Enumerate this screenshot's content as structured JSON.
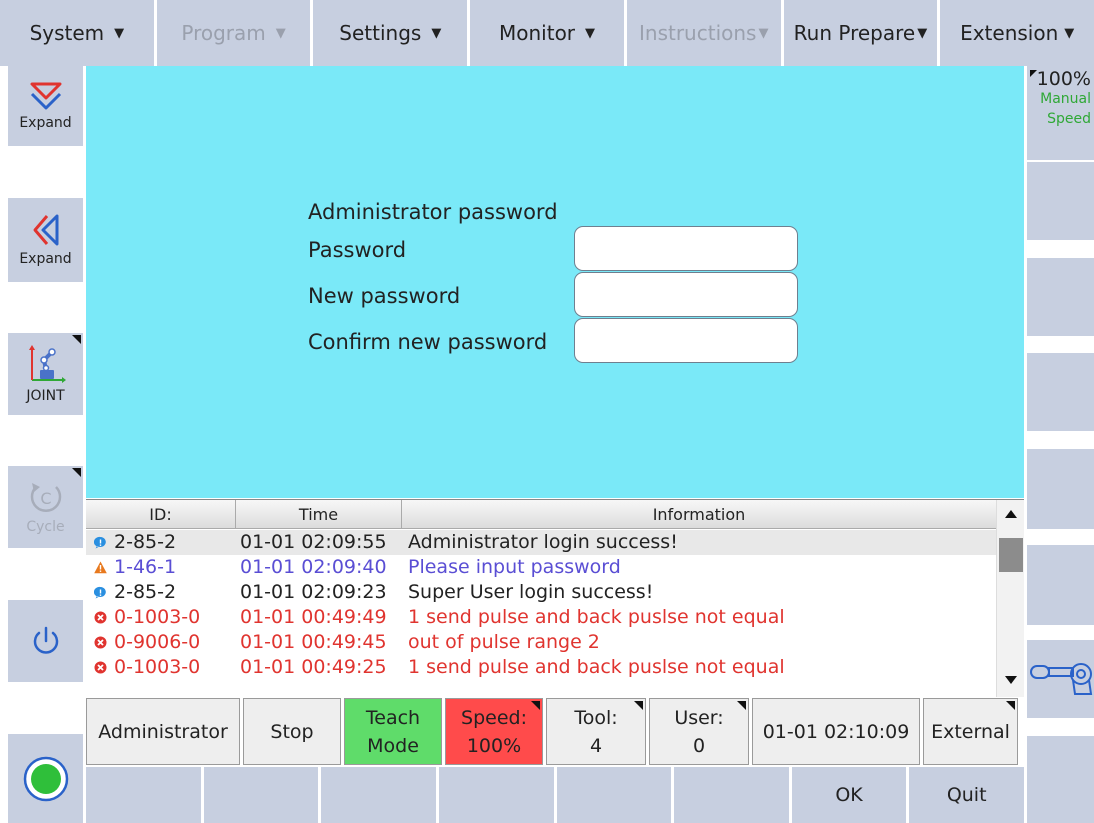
{
  "menu": [
    {
      "label": "System",
      "disabled": false
    },
    {
      "label": "Program",
      "disabled": true
    },
    {
      "label": "Settings",
      "disabled": false
    },
    {
      "label": "Monitor",
      "disabled": false
    },
    {
      "label": "Instructions",
      "disabled": true
    },
    {
      "label": "Run Prepare",
      "disabled": false
    },
    {
      "label": "Extension",
      "disabled": false
    }
  ],
  "left": {
    "expand_down": "Expand",
    "expand_left": "Expand",
    "coord": "JOINT",
    "cycle": "Cycle"
  },
  "speed": {
    "value": "100%",
    "mode": "Manual",
    "label": "Speed"
  },
  "form": {
    "title": "Administrator password",
    "password_label": "Password",
    "new_password_label": "New password",
    "confirm_label": "Confirm new password",
    "password_value": "",
    "new_password_value": "",
    "confirm_value": ""
  },
  "log": {
    "headers": {
      "id": "ID:",
      "time": "Time",
      "info": "Information"
    },
    "rows": [
      {
        "id": "2-85-2",
        "time": "01-01 02:09:55",
        "info": "Administrator login success!",
        "level": "info"
      },
      {
        "id": "1-46-1",
        "time": "01-01 02:09:40",
        "info": "Please input password",
        "level": "warning"
      },
      {
        "id": "2-85-2",
        "time": "01-01 02:09:23",
        "info": "Super User login success!",
        "level": "info"
      },
      {
        "id": "0-1003-0",
        "time": "01-01 00:49:49",
        "info": "1 send pulse and back puslse not equal",
        "level": "error"
      },
      {
        "id": "0-9006-0",
        "time": "01-01 00:49:45",
        "info": "out of pulse range 2",
        "level": "error"
      },
      {
        "id": "0-1003-0",
        "time": "01-01 00:49:25",
        "info": "1 send pulse and back puslse not equal",
        "level": "error"
      }
    ]
  },
  "status": {
    "user": "Administrator",
    "state": "Stop",
    "mode_line1": "Teach",
    "mode_line2": "Mode",
    "speed_line1": "Speed:",
    "speed_line2": "100%",
    "tool_line1": "Tool:",
    "tool_line2": "4",
    "userframe_line1": "User:",
    "userframe_line2": "0",
    "datetime": "01-01 02:10:09",
    "external": "External"
  },
  "fkeys": [
    "",
    "",
    "",
    "",
    "",
    "",
    "OK",
    "Quit"
  ],
  "colors": {
    "panel": "#7ae9f8",
    "button": "#c7cfe0",
    "teach_mode": "#5fdc6a",
    "speed_alert": "#ff4b4b",
    "error_text": "#e0342f",
    "warning_text": "#5a4ed4",
    "manual_text": "#2fa836"
  }
}
